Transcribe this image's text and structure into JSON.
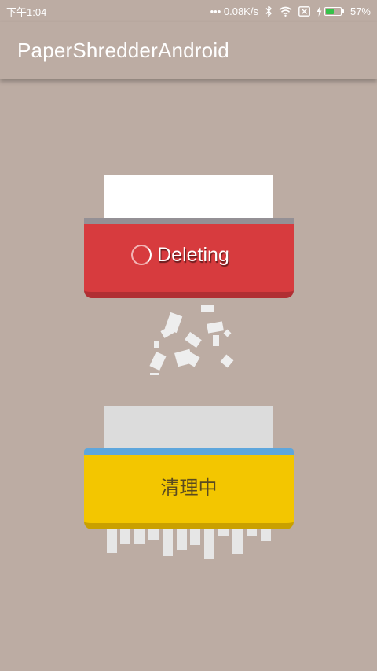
{
  "status_bar": {
    "time": "下午1:04",
    "network_speed": "••• 0.08K/s",
    "battery_percent": "57%",
    "battery_level": 0.57,
    "icons": [
      "bluetooth-icon",
      "wifi-icon",
      "sim-icon",
      "charging-icon",
      "battery-icon"
    ]
  },
  "app_bar": {
    "title": "PaperShredderAndroid"
  },
  "red_shredder": {
    "label": "Deleting",
    "color": "#d73b3e"
  },
  "yellow_shredder": {
    "label": "清理中",
    "color": "#f3c600"
  },
  "colors": {
    "background": "#bcaca3",
    "rim_gray": "#949095",
    "rim_blue": "#5ea6dc"
  }
}
